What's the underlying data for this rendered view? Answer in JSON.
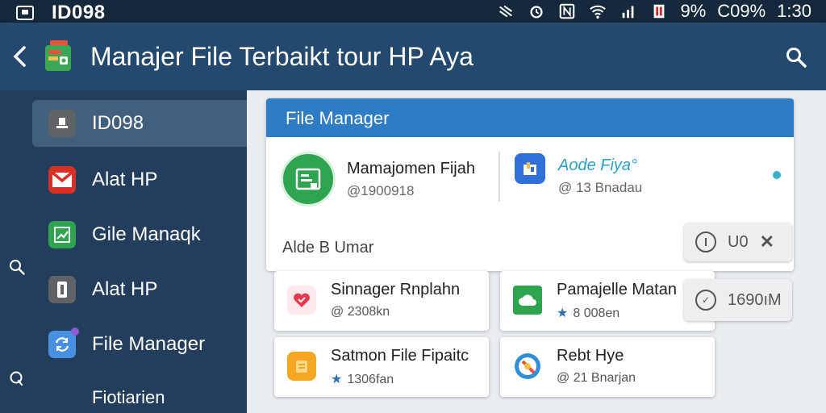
{
  "status_bar": {
    "title": "ID098",
    "battery_1": "9%",
    "battery_2": "C09%",
    "time": "1:30"
  },
  "header": {
    "title": "Manajer File Terbaikt tour HP Aya"
  },
  "sidebar": {
    "items": [
      {
        "label": "ID098",
        "icon": "archive-icon",
        "color": "#5f6368",
        "active": true
      },
      {
        "label": "Alat HP",
        "icon": "mail-icon",
        "color": "#d93025"
      },
      {
        "label": "Gile Manaqk",
        "icon": "chart-icon",
        "color": "#2ea44f"
      },
      {
        "label": "Alat HP",
        "icon": "info-icon",
        "color": "#5f6368"
      },
      {
        "label": "File Manager",
        "icon": "sync-icon",
        "color": "#4a90e2"
      },
      {
        "label": "Fiotiarien"
      }
    ]
  },
  "card": {
    "header": "File Manager",
    "entry_1": {
      "title": "Mamajomen Fijah",
      "sub": "@1900918"
    },
    "entry_2": {
      "title": "Aode Fiya°",
      "sub": "@ 13 Bnadau"
    },
    "footer": "Alde B Umar",
    "chip_1": "U0",
    "chip_2": "1690ıM"
  },
  "tiles": [
    {
      "title": "Sinnager Rnplahn",
      "sub": "@ 2308kn",
      "icon": "heart-icon",
      "color": "#e53950",
      "star": false
    },
    {
      "title": "Pamajelle Matan",
      "sub": "8 008en",
      "icon": "cloud-icon",
      "color": "#2ea44f",
      "star": true
    },
    {
      "title": "Satmon File Fipaitc",
      "sub": "1306fan",
      "icon": "folder-icon",
      "color": "#f5a623",
      "star": true
    },
    {
      "title": "Rebt Hye",
      "sub": "@ 21 Bnarjan",
      "icon": "compass-icon",
      "color": "#2f8fd8",
      "star": false
    }
  ],
  "colors": {
    "status_bar": "#16283c",
    "header": "#234a6e",
    "sidebar": "#223e5c",
    "active_item": "#42607d",
    "card_header": "#2e7cc4",
    "content_bg": "#e9edf1"
  }
}
